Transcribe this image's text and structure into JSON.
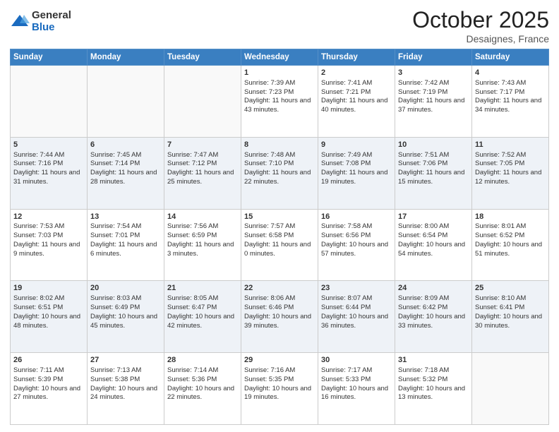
{
  "logo": {
    "general": "General",
    "blue": "Blue"
  },
  "header": {
    "month": "October 2025",
    "location": "Desaignes, France"
  },
  "weekdays": [
    "Sunday",
    "Monday",
    "Tuesday",
    "Wednesday",
    "Thursday",
    "Friday",
    "Saturday"
  ],
  "weeks": [
    [
      {
        "day": "",
        "sunrise": "",
        "sunset": "",
        "daylight": ""
      },
      {
        "day": "",
        "sunrise": "",
        "sunset": "",
        "daylight": ""
      },
      {
        "day": "",
        "sunrise": "",
        "sunset": "",
        "daylight": ""
      },
      {
        "day": "1",
        "sunrise": "Sunrise: 7:39 AM",
        "sunset": "Sunset: 7:23 PM",
        "daylight": "Daylight: 11 hours and 43 minutes."
      },
      {
        "day": "2",
        "sunrise": "Sunrise: 7:41 AM",
        "sunset": "Sunset: 7:21 PM",
        "daylight": "Daylight: 11 hours and 40 minutes."
      },
      {
        "day": "3",
        "sunrise": "Sunrise: 7:42 AM",
        "sunset": "Sunset: 7:19 PM",
        "daylight": "Daylight: 11 hours and 37 minutes."
      },
      {
        "day": "4",
        "sunrise": "Sunrise: 7:43 AM",
        "sunset": "Sunset: 7:17 PM",
        "daylight": "Daylight: 11 hours and 34 minutes."
      }
    ],
    [
      {
        "day": "5",
        "sunrise": "Sunrise: 7:44 AM",
        "sunset": "Sunset: 7:16 PM",
        "daylight": "Daylight: 11 hours and 31 minutes."
      },
      {
        "day": "6",
        "sunrise": "Sunrise: 7:45 AM",
        "sunset": "Sunset: 7:14 PM",
        "daylight": "Daylight: 11 hours and 28 minutes."
      },
      {
        "day": "7",
        "sunrise": "Sunrise: 7:47 AM",
        "sunset": "Sunset: 7:12 PM",
        "daylight": "Daylight: 11 hours and 25 minutes."
      },
      {
        "day": "8",
        "sunrise": "Sunrise: 7:48 AM",
        "sunset": "Sunset: 7:10 PM",
        "daylight": "Daylight: 11 hours and 22 minutes."
      },
      {
        "day": "9",
        "sunrise": "Sunrise: 7:49 AM",
        "sunset": "Sunset: 7:08 PM",
        "daylight": "Daylight: 11 hours and 19 minutes."
      },
      {
        "day": "10",
        "sunrise": "Sunrise: 7:51 AM",
        "sunset": "Sunset: 7:06 PM",
        "daylight": "Daylight: 11 hours and 15 minutes."
      },
      {
        "day": "11",
        "sunrise": "Sunrise: 7:52 AM",
        "sunset": "Sunset: 7:05 PM",
        "daylight": "Daylight: 11 hours and 12 minutes."
      }
    ],
    [
      {
        "day": "12",
        "sunrise": "Sunrise: 7:53 AM",
        "sunset": "Sunset: 7:03 PM",
        "daylight": "Daylight: 11 hours and 9 minutes."
      },
      {
        "day": "13",
        "sunrise": "Sunrise: 7:54 AM",
        "sunset": "Sunset: 7:01 PM",
        "daylight": "Daylight: 11 hours and 6 minutes."
      },
      {
        "day": "14",
        "sunrise": "Sunrise: 7:56 AM",
        "sunset": "Sunset: 6:59 PM",
        "daylight": "Daylight: 11 hours and 3 minutes."
      },
      {
        "day": "15",
        "sunrise": "Sunrise: 7:57 AM",
        "sunset": "Sunset: 6:58 PM",
        "daylight": "Daylight: 11 hours and 0 minutes."
      },
      {
        "day": "16",
        "sunrise": "Sunrise: 7:58 AM",
        "sunset": "Sunset: 6:56 PM",
        "daylight": "Daylight: 10 hours and 57 minutes."
      },
      {
        "day": "17",
        "sunrise": "Sunrise: 8:00 AM",
        "sunset": "Sunset: 6:54 PM",
        "daylight": "Daylight: 10 hours and 54 minutes."
      },
      {
        "day": "18",
        "sunrise": "Sunrise: 8:01 AM",
        "sunset": "Sunset: 6:52 PM",
        "daylight": "Daylight: 10 hours and 51 minutes."
      }
    ],
    [
      {
        "day": "19",
        "sunrise": "Sunrise: 8:02 AM",
        "sunset": "Sunset: 6:51 PM",
        "daylight": "Daylight: 10 hours and 48 minutes."
      },
      {
        "day": "20",
        "sunrise": "Sunrise: 8:03 AM",
        "sunset": "Sunset: 6:49 PM",
        "daylight": "Daylight: 10 hours and 45 minutes."
      },
      {
        "day": "21",
        "sunrise": "Sunrise: 8:05 AM",
        "sunset": "Sunset: 6:47 PM",
        "daylight": "Daylight: 10 hours and 42 minutes."
      },
      {
        "day": "22",
        "sunrise": "Sunrise: 8:06 AM",
        "sunset": "Sunset: 6:46 PM",
        "daylight": "Daylight: 10 hours and 39 minutes."
      },
      {
        "day": "23",
        "sunrise": "Sunrise: 8:07 AM",
        "sunset": "Sunset: 6:44 PM",
        "daylight": "Daylight: 10 hours and 36 minutes."
      },
      {
        "day": "24",
        "sunrise": "Sunrise: 8:09 AM",
        "sunset": "Sunset: 6:42 PM",
        "daylight": "Daylight: 10 hours and 33 minutes."
      },
      {
        "day": "25",
        "sunrise": "Sunrise: 8:10 AM",
        "sunset": "Sunset: 6:41 PM",
        "daylight": "Daylight: 10 hours and 30 minutes."
      }
    ],
    [
      {
        "day": "26",
        "sunrise": "Sunrise: 7:11 AM",
        "sunset": "Sunset: 5:39 PM",
        "daylight": "Daylight: 10 hours and 27 minutes."
      },
      {
        "day": "27",
        "sunrise": "Sunrise: 7:13 AM",
        "sunset": "Sunset: 5:38 PM",
        "daylight": "Daylight: 10 hours and 24 minutes."
      },
      {
        "day": "28",
        "sunrise": "Sunrise: 7:14 AM",
        "sunset": "Sunset: 5:36 PM",
        "daylight": "Daylight: 10 hours and 22 minutes."
      },
      {
        "day": "29",
        "sunrise": "Sunrise: 7:16 AM",
        "sunset": "Sunset: 5:35 PM",
        "daylight": "Daylight: 10 hours and 19 minutes."
      },
      {
        "day": "30",
        "sunrise": "Sunrise: 7:17 AM",
        "sunset": "Sunset: 5:33 PM",
        "daylight": "Daylight: 10 hours and 16 minutes."
      },
      {
        "day": "31",
        "sunrise": "Sunrise: 7:18 AM",
        "sunset": "Sunset: 5:32 PM",
        "daylight": "Daylight: 10 hours and 13 minutes."
      },
      {
        "day": "",
        "sunrise": "",
        "sunset": "",
        "daylight": ""
      }
    ]
  ]
}
